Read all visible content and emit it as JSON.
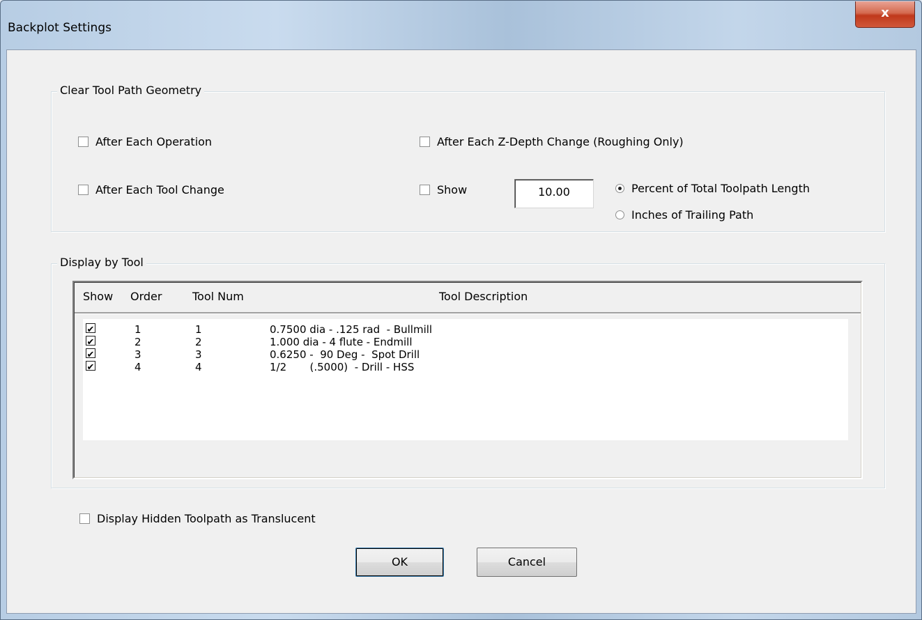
{
  "window": {
    "title": "Backplot Settings",
    "close_label": "x"
  },
  "clear_group": {
    "legend": "Clear Tool Path Geometry",
    "after_each_operation": "After Each Operation",
    "after_each_z_depth": "After Each Z-Depth Change (Roughing Only)",
    "after_each_tool_change": "After Each Tool Change",
    "show_label": "Show",
    "show_value": "10.00",
    "percent_option": "Percent of Total Toolpath Length",
    "inches_option": "Inches of Trailing Path"
  },
  "tool_group": {
    "legend": "Display by Tool",
    "columns": [
      "Show",
      "Order",
      "Tool Num",
      "Tool Description"
    ],
    "rows": [
      {
        "show": true,
        "order": "1",
        "tool_num": "1",
        "description": "0.7500 dia - .125 rad  - Bullmill"
      },
      {
        "show": true,
        "order": "2",
        "tool_num": "2",
        "description": "1.000 dia - 4 flute - Endmill"
      },
      {
        "show": true,
        "order": "3",
        "tool_num": "3",
        "description": "0.6250 -  90 Deg -  Spot Drill"
      },
      {
        "show": true,
        "order": "4",
        "tool_num": "4",
        "description": "1/2       (.5000)  - Drill - HSS"
      }
    ],
    "check_glyph": "✔"
  },
  "translucent_label": "Display Hidden Toolpath as Translucent",
  "buttons": {
    "ok": "OK",
    "cancel": "Cancel"
  }
}
